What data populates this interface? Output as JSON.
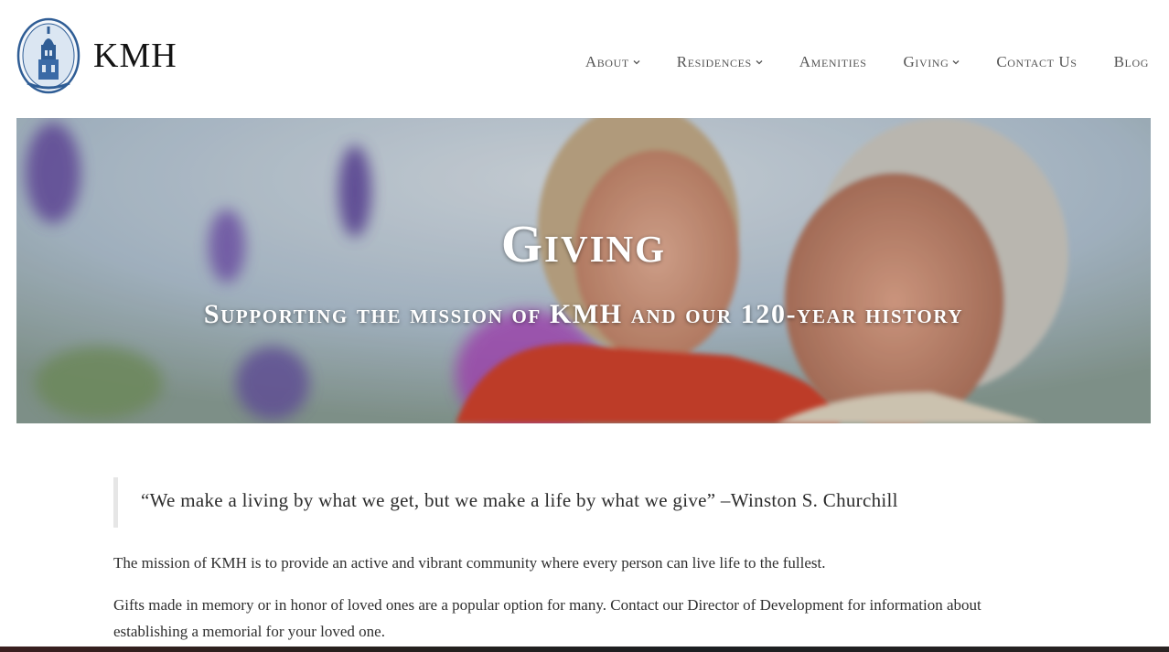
{
  "brand": {
    "name": "KMH",
    "logo_icon": "tower-seal-icon"
  },
  "nav": {
    "items": [
      {
        "label": "About",
        "has_dropdown": true
      },
      {
        "label": "Residences",
        "has_dropdown": true
      },
      {
        "label": "Amenities",
        "has_dropdown": false
      },
      {
        "label": "Giving",
        "has_dropdown": true
      },
      {
        "label": "Contact Us",
        "has_dropdown": false
      },
      {
        "label": "Blog",
        "has_dropdown": false
      }
    ]
  },
  "hero": {
    "title": "Giving",
    "subtitle": "Supporting the mission of KMH and our 120-year history"
  },
  "content": {
    "quote": "“We make a living by what we get, but we make a life by what we give” –Winston S. Churchill",
    "paragraphs": [
      "The mission of KMH is to provide an active and vibrant community where every person can live life to the fullest.",
      "Gifts made in memory or in honor of loved ones are a popular option for many. Contact our Director of Development for information about establishing a memorial for your loved one."
    ]
  },
  "colors": {
    "nav_text": "#555555",
    "hero_text": "#ffffff",
    "logo_blue": "#2f5d95"
  }
}
